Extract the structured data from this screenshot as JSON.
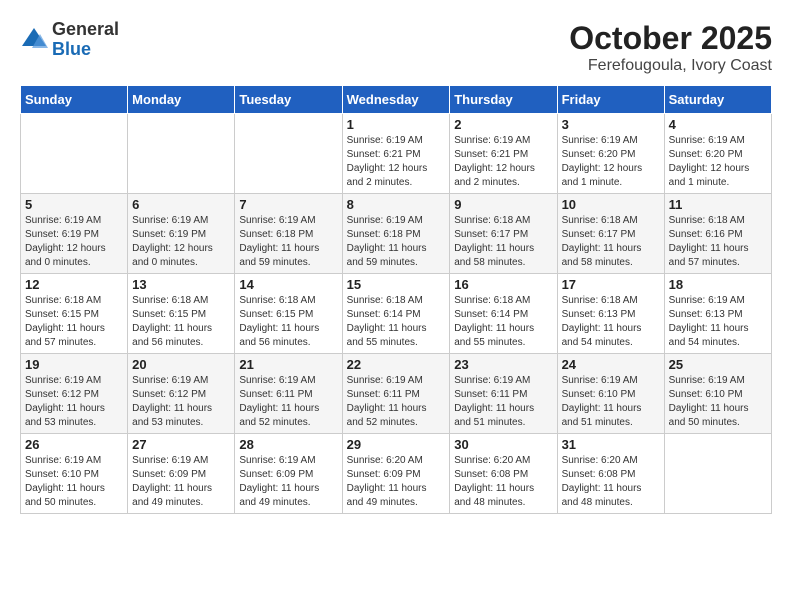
{
  "header": {
    "logo": {
      "line1": "General",
      "line2": "Blue"
    },
    "month": "October 2025",
    "location": "Ferefougoula, Ivory Coast"
  },
  "weekdays": [
    "Sunday",
    "Monday",
    "Tuesday",
    "Wednesday",
    "Thursday",
    "Friday",
    "Saturday"
  ],
  "weeks": [
    [
      {
        "day": "",
        "info": ""
      },
      {
        "day": "",
        "info": ""
      },
      {
        "day": "",
        "info": ""
      },
      {
        "day": "1",
        "info": "Sunrise: 6:19 AM\nSunset: 6:21 PM\nDaylight: 12 hours and 2 minutes."
      },
      {
        "day": "2",
        "info": "Sunrise: 6:19 AM\nSunset: 6:21 PM\nDaylight: 12 hours and 2 minutes."
      },
      {
        "day": "3",
        "info": "Sunrise: 6:19 AM\nSunset: 6:20 PM\nDaylight: 12 hours and 1 minute."
      },
      {
        "day": "4",
        "info": "Sunrise: 6:19 AM\nSunset: 6:20 PM\nDaylight: 12 hours and 1 minute."
      }
    ],
    [
      {
        "day": "5",
        "info": "Sunrise: 6:19 AM\nSunset: 6:19 PM\nDaylight: 12 hours and 0 minutes."
      },
      {
        "day": "6",
        "info": "Sunrise: 6:19 AM\nSunset: 6:19 PM\nDaylight: 12 hours and 0 minutes."
      },
      {
        "day": "7",
        "info": "Sunrise: 6:19 AM\nSunset: 6:18 PM\nDaylight: 11 hours and 59 minutes."
      },
      {
        "day": "8",
        "info": "Sunrise: 6:19 AM\nSunset: 6:18 PM\nDaylight: 11 hours and 59 minutes."
      },
      {
        "day": "9",
        "info": "Sunrise: 6:18 AM\nSunset: 6:17 PM\nDaylight: 11 hours and 58 minutes."
      },
      {
        "day": "10",
        "info": "Sunrise: 6:18 AM\nSunset: 6:17 PM\nDaylight: 11 hours and 58 minutes."
      },
      {
        "day": "11",
        "info": "Sunrise: 6:18 AM\nSunset: 6:16 PM\nDaylight: 11 hours and 57 minutes."
      }
    ],
    [
      {
        "day": "12",
        "info": "Sunrise: 6:18 AM\nSunset: 6:15 PM\nDaylight: 11 hours and 57 minutes."
      },
      {
        "day": "13",
        "info": "Sunrise: 6:18 AM\nSunset: 6:15 PM\nDaylight: 11 hours and 56 minutes."
      },
      {
        "day": "14",
        "info": "Sunrise: 6:18 AM\nSunset: 6:15 PM\nDaylight: 11 hours and 56 minutes."
      },
      {
        "day": "15",
        "info": "Sunrise: 6:18 AM\nSunset: 6:14 PM\nDaylight: 11 hours and 55 minutes."
      },
      {
        "day": "16",
        "info": "Sunrise: 6:18 AM\nSunset: 6:14 PM\nDaylight: 11 hours and 55 minutes."
      },
      {
        "day": "17",
        "info": "Sunrise: 6:18 AM\nSunset: 6:13 PM\nDaylight: 11 hours and 54 minutes."
      },
      {
        "day": "18",
        "info": "Sunrise: 6:19 AM\nSunset: 6:13 PM\nDaylight: 11 hours and 54 minutes."
      }
    ],
    [
      {
        "day": "19",
        "info": "Sunrise: 6:19 AM\nSunset: 6:12 PM\nDaylight: 11 hours and 53 minutes."
      },
      {
        "day": "20",
        "info": "Sunrise: 6:19 AM\nSunset: 6:12 PM\nDaylight: 11 hours and 53 minutes."
      },
      {
        "day": "21",
        "info": "Sunrise: 6:19 AM\nSunset: 6:11 PM\nDaylight: 11 hours and 52 minutes."
      },
      {
        "day": "22",
        "info": "Sunrise: 6:19 AM\nSunset: 6:11 PM\nDaylight: 11 hours and 52 minutes."
      },
      {
        "day": "23",
        "info": "Sunrise: 6:19 AM\nSunset: 6:11 PM\nDaylight: 11 hours and 51 minutes."
      },
      {
        "day": "24",
        "info": "Sunrise: 6:19 AM\nSunset: 6:10 PM\nDaylight: 11 hours and 51 minutes."
      },
      {
        "day": "25",
        "info": "Sunrise: 6:19 AM\nSunset: 6:10 PM\nDaylight: 11 hours and 50 minutes."
      }
    ],
    [
      {
        "day": "26",
        "info": "Sunrise: 6:19 AM\nSunset: 6:10 PM\nDaylight: 11 hours and 50 minutes."
      },
      {
        "day": "27",
        "info": "Sunrise: 6:19 AM\nSunset: 6:09 PM\nDaylight: 11 hours and 49 minutes."
      },
      {
        "day": "28",
        "info": "Sunrise: 6:19 AM\nSunset: 6:09 PM\nDaylight: 11 hours and 49 minutes."
      },
      {
        "day": "29",
        "info": "Sunrise: 6:20 AM\nSunset: 6:09 PM\nDaylight: 11 hours and 49 minutes."
      },
      {
        "day": "30",
        "info": "Sunrise: 6:20 AM\nSunset: 6:08 PM\nDaylight: 11 hours and 48 minutes."
      },
      {
        "day": "31",
        "info": "Sunrise: 6:20 AM\nSunset: 6:08 PM\nDaylight: 11 hours and 48 minutes."
      },
      {
        "day": "",
        "info": ""
      }
    ]
  ]
}
